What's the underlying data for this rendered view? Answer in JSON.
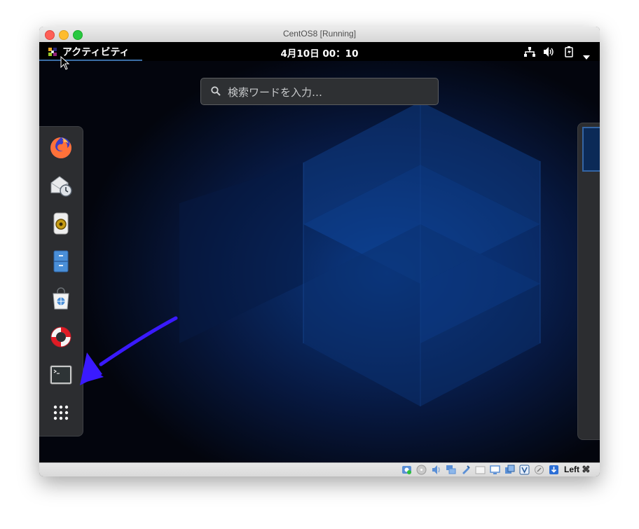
{
  "window": {
    "title": "CentOS8 [Running]"
  },
  "gnome": {
    "activities_label": "アクティビティ",
    "clock": "4月10日  00：10",
    "tray": [
      "network-icon",
      "volume-icon",
      "battery-icon",
      "system-menu-arrow-icon"
    ]
  },
  "search": {
    "placeholder": "検索ワードを入力…"
  },
  "dash": {
    "items": [
      "firefox-icon",
      "evolution-mail-icon",
      "rhythmbox-speaker-icon",
      "files-cabinet-icon",
      "software-bag-icon",
      "help-lifebuoy-icon",
      "terminal-icon",
      "show-applications-grid-icon"
    ]
  },
  "annotation": {
    "arrow_color": "#3a1aff",
    "points_to": "terminal-icon"
  },
  "statusbar": {
    "icons": [
      "hard-disk-icon",
      "optical-drive-icon",
      "audio-icon",
      "network-adapter-icon",
      "usb-icon",
      "shared-folder-icon",
      "display-icon",
      "video-capture-icon",
      "vbox-icon",
      "mouse-integration-icon",
      "keyboard-icon"
    ],
    "host_key": "Left ⌘"
  },
  "colors": {
    "accent": "#3465a4",
    "panel": "#2c2d30",
    "topbar": "#000000"
  }
}
